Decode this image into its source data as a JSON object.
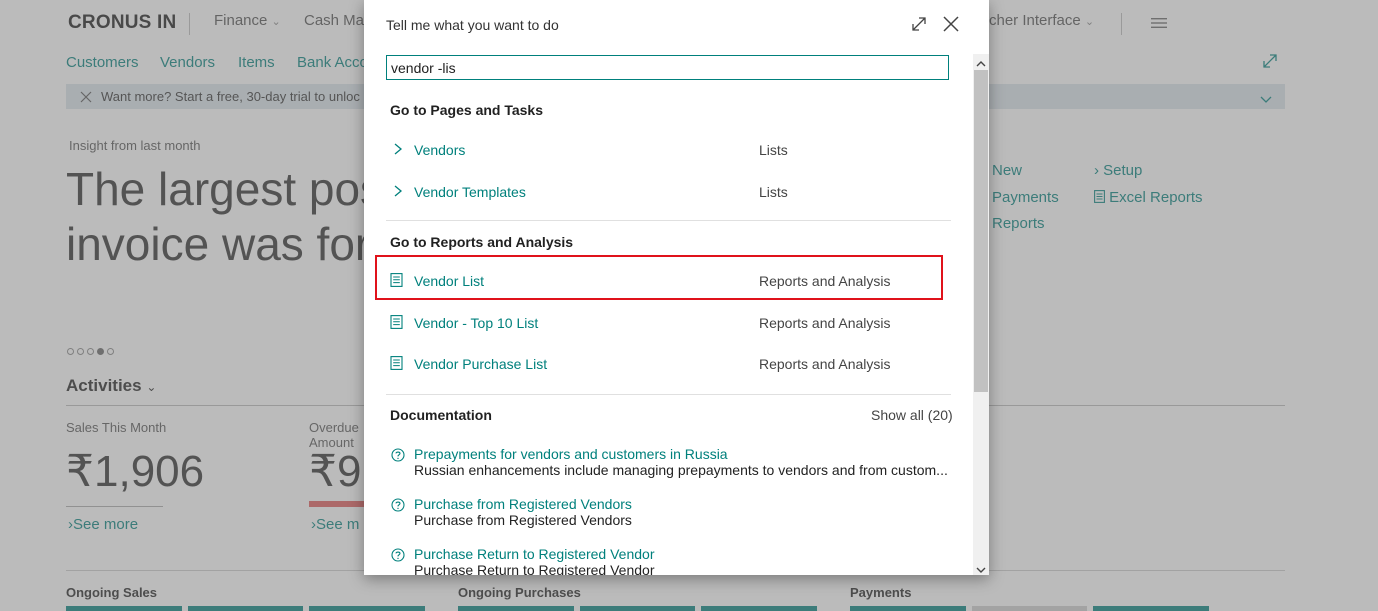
{
  "app": {
    "brand": "CRONUS IN",
    "top_nav": [
      "Finance",
      "Cash Ma",
      "cher Interface"
    ],
    "secondary_nav": [
      "Customers",
      "Vendors",
      "Items",
      "Bank Acco"
    ],
    "banner_text": "Want more? Start a free, 30-day trial to unloc",
    "insight_label": "Insight from last month",
    "insight_line1": "The largest pos",
    "insight_line2": "invoice was for",
    "actions_col1": [
      "New",
      "Payments",
      "Reports"
    ],
    "actions_col2": [
      "Setup",
      "Excel Reports"
    ],
    "activities_title": "Activities",
    "kpi1_label": "Sales This Month",
    "kpi1_value": "₹1,906",
    "kpi1_link": "See more",
    "kpi2_label_1": "Overdue",
    "kpi2_label_2": "Amount",
    "kpi2_value": "₹9",
    "kpi2_link": "See m",
    "bottom_sections": [
      "Ongoing Sales",
      "Ongoing Purchases",
      "Payments"
    ]
  },
  "dialog": {
    "title": "Tell me what you want to do",
    "search_value": "vendor -lis",
    "sections": {
      "pages": {
        "heading": "Go to Pages and Tasks",
        "rows": [
          {
            "label": "Vendors",
            "category": "Lists"
          },
          {
            "label": "Vendor Templates",
            "category": "Lists"
          }
        ]
      },
      "reports": {
        "heading": "Go to Reports and Analysis",
        "rows": [
          {
            "label": "Vendor List",
            "category": "Reports and Analysis"
          },
          {
            "label": "Vendor - Top 10 List",
            "category": "Reports and Analysis"
          },
          {
            "label": "Vendor Purchase List",
            "category": "Reports and Analysis"
          }
        ]
      },
      "docs": {
        "heading": "Documentation",
        "show_all": "Show all (20)",
        "items": [
          {
            "title": "Prepayments for vendors and customers in Russia",
            "desc": "Russian enhancements include managing prepayments to vendors and from custom..."
          },
          {
            "title": "Purchase from Registered Vendors",
            "desc": "Purchase from Registered Vendors"
          },
          {
            "title": "Purchase Return to Registered Vendor",
            "desc": "Purchase Return to Registered Vendor"
          }
        ]
      }
    }
  },
  "colors": {
    "accent": "#00807c",
    "highlight": "#e0121b"
  }
}
